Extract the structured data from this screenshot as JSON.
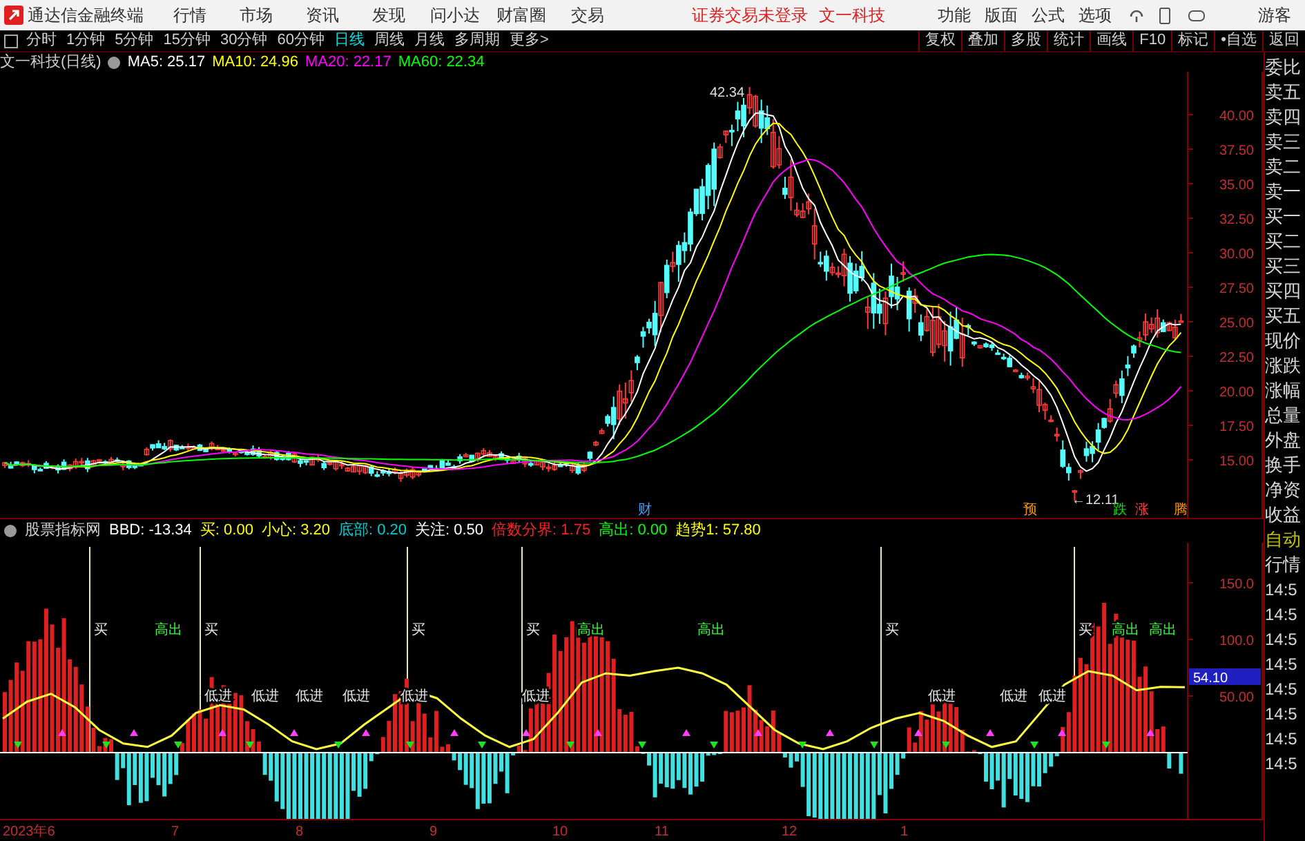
{
  "app": {
    "title": "通达信金融终端",
    "menu": [
      "行情",
      "市场",
      "资讯",
      "发现",
      "问小达",
      "财富圈",
      "交易"
    ],
    "notice": "证券交易未登录",
    "stock_link": "文一科技",
    "right_menu": [
      "功能",
      "版面",
      "公式",
      "选项"
    ],
    "user": "游客"
  },
  "periods": [
    {
      "label": "分时",
      "selected": false
    },
    {
      "label": "1分钟",
      "selected": false
    },
    {
      "label": "5分钟",
      "selected": false
    },
    {
      "label": "15分钟",
      "selected": false
    },
    {
      "label": "30分钟",
      "selected": false
    },
    {
      "label": "60分钟",
      "selected": false
    },
    {
      "label": "日线",
      "selected": true
    },
    {
      "label": "周线",
      "selected": false
    },
    {
      "label": "月线",
      "selected": false
    },
    {
      "label": "多周期",
      "selected": false
    },
    {
      "label": "更多>",
      "selected": false
    }
  ],
  "tools": [
    "复权",
    "叠加",
    "多股",
    "统计",
    "画线",
    "F10",
    "标记",
    "•自选",
    "返回"
  ],
  "legend": {
    "title": "文一科技(日线)",
    "ma": [
      {
        "label": "MA5: 25.17",
        "color": "#ffffff"
      },
      {
        "label": "MA10: 24.96",
        "color": "#ffff00"
      },
      {
        "label": "MA20: 22.17",
        "color": "#ff00ff"
      },
      {
        "label": "MA60: 22.34",
        "color": "#00ff00"
      }
    ]
  },
  "price_axis": [
    "40.00",
    "37.50",
    "35.00",
    "32.50",
    "30.00",
    "27.50",
    "25.00",
    "22.50",
    "20.00",
    "17.50",
    "15.00"
  ],
  "price_annotations": {
    "high": "42.34",
    "low": "←12.11"
  },
  "event_marks": [
    {
      "label": "财",
      "color": "#3aa0ff"
    },
    {
      "label": "预",
      "color": "#ff9900"
    },
    {
      "label": "跌",
      "color": "#00e000"
    },
    {
      "label": "涨",
      "color": "#ff4040"
    },
    {
      "label": "腾",
      "color": "#ff9900"
    }
  ],
  "indicator": {
    "name": "股票指标网",
    "values": [
      {
        "text": "BBD: -13.34",
        "color": "#ffffff"
      },
      {
        "text": "买: 0.00",
        "color": "#ffff00"
      },
      {
        "text": "小心: 3.20",
        "color": "#ffff00"
      },
      {
        "text": "底部: 0.20",
        "color": "#00cccc"
      },
      {
        "text": "关注: 0.50",
        "color": "#ffffff"
      },
      {
        "text": "倍数分界: 1.75",
        "color": "#ff2020"
      },
      {
        "text": "高出: 0.00",
        "color": "#00ff00"
      },
      {
        "text": "趋势1: 57.80",
        "color": "#ffff00"
      }
    ]
  },
  "indicator_axis": [
    "150.0",
    "100.0",
    "50.00"
  ],
  "indicator_current": "54.10",
  "buy_signals": [
    "买",
    "买",
    "买",
    "买",
    "买",
    "买"
  ],
  "high_signals": [
    "高出",
    "高出",
    "高出",
    "高出",
    "高出"
  ],
  "low_signals": [
    "低进",
    "低进",
    "低进",
    "低进",
    "低进",
    "低进",
    "低进",
    "低进",
    "低进"
  ],
  "quote_panel": [
    "委比",
    "卖五",
    "卖四",
    "卖三",
    "卖二",
    "卖一",
    "买一",
    "买二",
    "买三",
    "买四",
    "买五",
    "现价",
    "涨跌",
    "涨幅",
    "总量",
    "外盘",
    "换手",
    "净资",
    "收益"
  ],
  "quote_mode": [
    "自动",
    "行情"
  ],
  "times": [
    "14:5",
    "14:5",
    "14:5",
    "14:5",
    "14:5",
    "14:5",
    "14:5",
    "14:5"
  ],
  "dates": [
    "2023年6",
    "7",
    "8",
    "9",
    "10",
    "11",
    "12",
    "1"
  ]
}
